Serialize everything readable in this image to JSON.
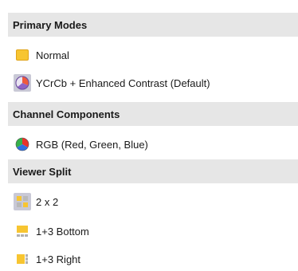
{
  "menu": {
    "sections": [
      {
        "title": "Primary Modes",
        "items": [
          {
            "label": "Normal",
            "icon": "yellow-square-icon",
            "selected": false
          },
          {
            "label": "YCrCb + Enhanced Contrast (Default)",
            "icon": "ycrcb-pie-icon",
            "selected": true
          }
        ]
      },
      {
        "title": "Channel Components",
        "items": [
          {
            "label": "RGB  (Red, Green, Blue)",
            "icon": "rgb-wheel-icon",
            "selected": false
          }
        ]
      },
      {
        "title": "Viewer Split",
        "items": [
          {
            "label": "2 x 2",
            "icon": "grid-2x2-icon",
            "selected": true
          },
          {
            "label": "1+3 Bottom",
            "icon": "split-bottom-icon",
            "selected": false
          },
          {
            "label": "1+3 Right",
            "icon": "split-right-icon",
            "selected": false
          }
        ]
      }
    ]
  },
  "colors": {
    "section_bg": "#e6e6e6",
    "selected_bg": "#c9c9d6",
    "icon_yellow": "#f7c531",
    "icon_yellow_dark": "#e0a418"
  }
}
